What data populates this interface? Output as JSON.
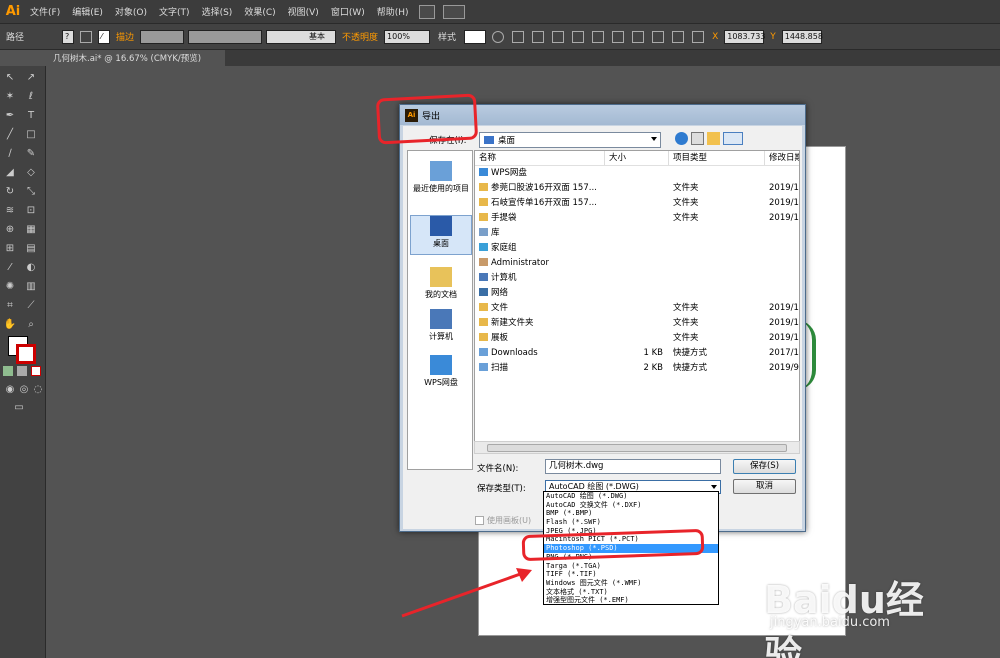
{
  "app": {
    "logo_text": "Ai",
    "menu": [
      "文件(F)",
      "编辑(E)",
      "对象(O)",
      "文字(T)",
      "选择(S)",
      "效果(C)",
      "视图(V)",
      "窗口(W)",
      "帮助(H)"
    ]
  },
  "controlbar": {
    "path_label": "路径",
    "stroke_label": "描边",
    "stroke_style": "基本",
    "opacity_label": "不透明度",
    "opacity_value": "100%",
    "style_label": "样式",
    "x_label": "X",
    "x_value": "1083.733",
    "y_label": "Y",
    "y_value": "1448.858"
  },
  "document_tab": {
    "title": "几何树木.ai* @ 16.67% (CMYK/预览)"
  },
  "dialog": {
    "title": "导出",
    "save_in_label": "保存在(I):",
    "current_folder": "桌面",
    "places": [
      {
        "label": "最近使用的项目",
        "selected": false
      },
      {
        "label": "桌面",
        "selected": true
      },
      {
        "label": "我的文档",
        "selected": false
      },
      {
        "label": "计算机",
        "selected": false
      },
      {
        "label": "WPS网盘",
        "selected": false
      }
    ],
    "columns": {
      "name": "名称",
      "size": "大小",
      "type": "项目类型",
      "modified": "修改日期"
    },
    "files": [
      {
        "name": "WPS网盘",
        "size": "",
        "type": "",
        "modified": "",
        "icon": "cloud"
      },
      {
        "name": "参莞口股波16开双面 157...",
        "size": "",
        "type": "文件夹",
        "modified": "2019/1",
        "icon": "folder"
      },
      {
        "name": "石岐宣传单16开双面 157...",
        "size": "",
        "type": "文件夹",
        "modified": "2019/1",
        "icon": "folder"
      },
      {
        "name": "手提袋",
        "size": "",
        "type": "文件夹",
        "modified": "2019/1",
        "icon": "folder"
      },
      {
        "name": "库",
        "size": "",
        "type": "",
        "modified": "",
        "icon": "library"
      },
      {
        "name": "家庭组",
        "size": "",
        "type": "",
        "modified": "",
        "icon": "homegroup"
      },
      {
        "name": "Administrator",
        "size": "",
        "type": "",
        "modified": "",
        "icon": "user"
      },
      {
        "name": "计算机",
        "size": "",
        "type": "",
        "modified": "",
        "icon": "computer"
      },
      {
        "name": "网络",
        "size": "",
        "type": "",
        "modified": "",
        "icon": "network"
      },
      {
        "name": "文件",
        "size": "",
        "type": "文件夹",
        "modified": "2019/1",
        "icon": "folder"
      },
      {
        "name": "新建文件夹",
        "size": "",
        "type": "文件夹",
        "modified": "2019/1",
        "icon": "folder"
      },
      {
        "name": "展板",
        "size": "",
        "type": "文件夹",
        "modified": "2019/1",
        "icon": "folder"
      },
      {
        "name": "Downloads",
        "size": "1 KB",
        "type": "快捷方式",
        "modified": "2017/1",
        "icon": "shortcut"
      },
      {
        "name": "扫描",
        "size": "2 KB",
        "type": "快捷方式",
        "modified": "2019/9",
        "icon": "shortcut"
      }
    ],
    "filename_label": "文件名(N):",
    "filename_value": "几何树木.dwg",
    "filetype_label": "保存类型(T):",
    "filetype_value": "AutoCAD 绘图 (*.DWG)",
    "save_button": "保存(S)",
    "cancel_button": "取消",
    "use_artboards_label": "使用画板(U)",
    "filetype_options": [
      {
        "label": "AutoCAD 绘图 (*.DWG)",
        "selected": false
      },
      {
        "label": "AutoCAD 交换文件 (*.DXF)",
        "selected": false
      },
      {
        "label": "BMP (*.BMP)",
        "selected": false
      },
      {
        "label": "Flash (*.SWF)",
        "selected": false
      },
      {
        "label": "JPEG (*.JPG)",
        "selected": false
      },
      {
        "label": "Macintosh PICT (*.PCT)",
        "selected": false
      },
      {
        "label": "Photoshop (*.PSD)",
        "selected": true
      },
      {
        "label": "PNG (*.PNG)",
        "selected": false
      },
      {
        "label": "Targa (*.TGA)",
        "selected": false
      },
      {
        "label": "TIFF (*.TIF)",
        "selected": false
      },
      {
        "label": "Windows 图元文件 (*.WMF)",
        "selected": false
      },
      {
        "label": "文本格式 (*.TXT)",
        "selected": false
      },
      {
        "label": "增强型图元文件 (*.EMF)",
        "selected": false
      }
    ]
  },
  "watermark": {
    "main": "Baidu经验",
    "sub": "jingyan.baidu.com"
  },
  "colors": {
    "annotation_red": "#e8242a",
    "selection_blue": "#3399ff",
    "ai_orange": "#ff9a00"
  }
}
